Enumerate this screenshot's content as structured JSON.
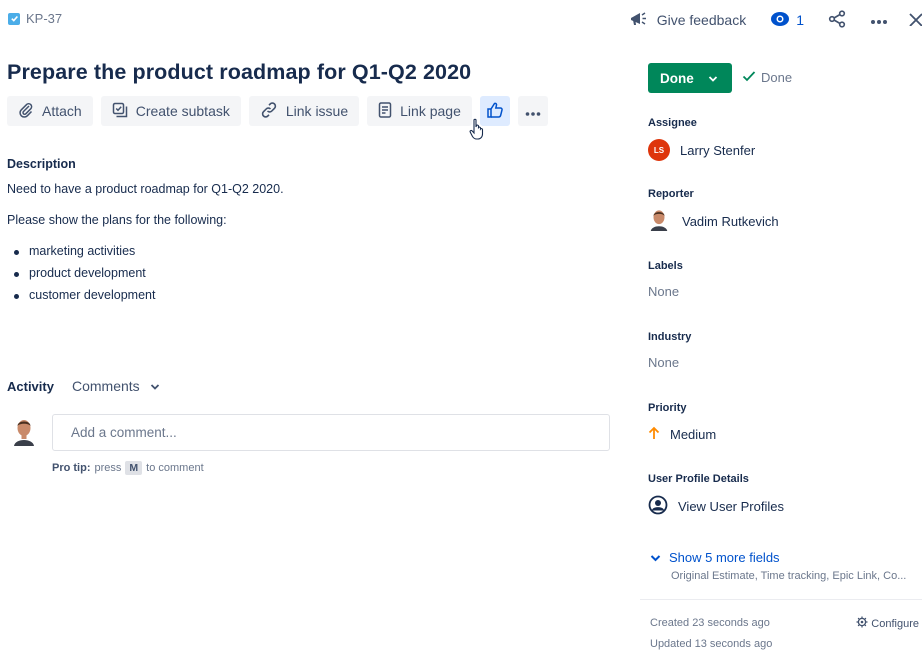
{
  "header": {
    "issue_key": "KP-37",
    "give_feedback": "Give feedback",
    "watch_count": "1"
  },
  "issue": {
    "title": "Prepare the product roadmap for Q1-Q2 2020"
  },
  "toolbar": {
    "attach": "Attach",
    "create_subtask": "Create subtask",
    "link_issue": "Link issue",
    "link_page": "Link page"
  },
  "description": {
    "label": "Description",
    "para1": "Need to have a product roadmap for Q1-Q2 2020.",
    "para2": "Please show the plans for the following:",
    "bullets": [
      "marketing activities",
      "product development",
      "customer development"
    ]
  },
  "activity": {
    "label": "Activity",
    "filter": "Comments",
    "comment_placeholder": "Add a comment...",
    "protip_label": "Pro tip:",
    "protip_pre": "press",
    "protip_key": "M",
    "protip_post": "to comment"
  },
  "status": {
    "button": "Done",
    "resolution": "Done"
  },
  "fields": {
    "assignee_label": "Assignee",
    "assignee_initials": "LS",
    "assignee_name": "Larry Stenfer",
    "reporter_label": "Reporter",
    "reporter_name": "Vadim Rutkevich",
    "labels_label": "Labels",
    "labels_value": "None",
    "industry_label": "Industry",
    "industry_value": "None",
    "priority_label": "Priority",
    "priority_value": "Medium",
    "user_profile_label": "User Profile Details",
    "user_profile_value": "View User Profiles"
  },
  "more_fields": {
    "label": "Show 5 more fields",
    "sub": "Original Estimate, Time tracking, Epic Link, Co..."
  },
  "meta": {
    "created": "Created 23 seconds ago",
    "updated": "Updated 13 seconds ago",
    "configure": "Configure"
  },
  "colors": {
    "accent": "#0052cc",
    "done_green": "#00875a",
    "priority_orange": "#ff8b00",
    "assignee_avatar": "#de350b"
  }
}
